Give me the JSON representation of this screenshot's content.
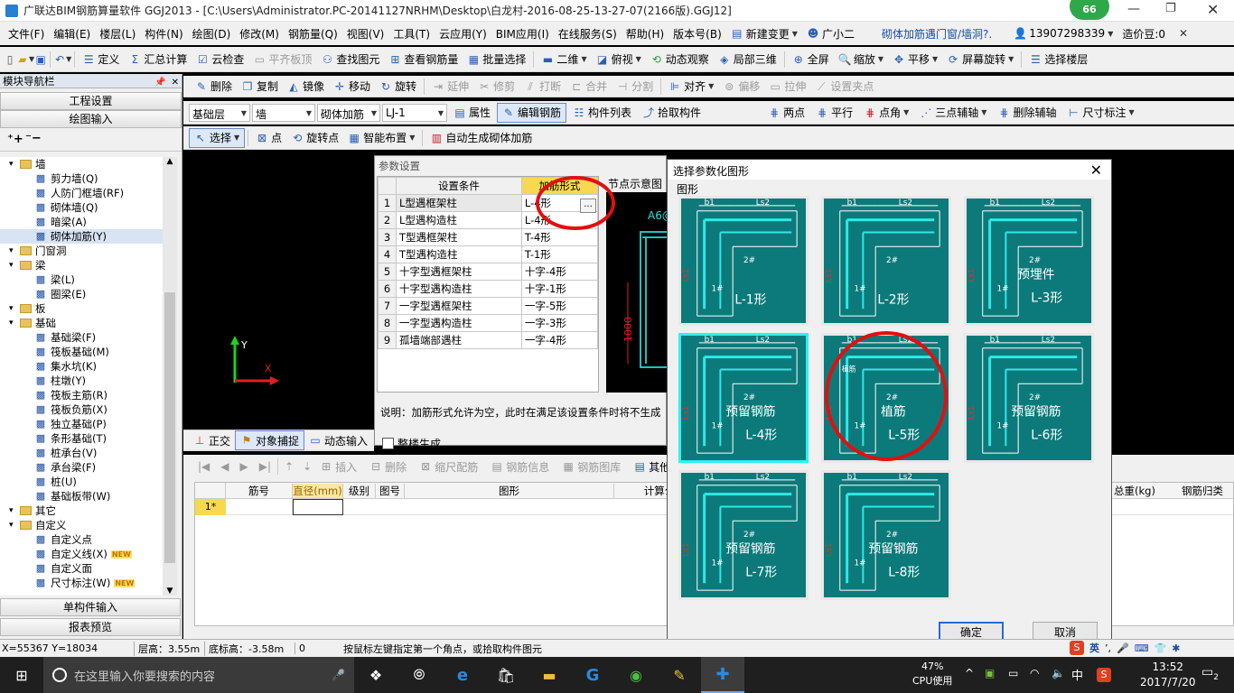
{
  "title": {
    "text": "广联达BIM钢筋算量软件 GGJ2013 - [C:\\Users\\Administrator.PC-20141127NRHM\\Desktop\\白龙村-2016-08-25-13-27-07(2166版).GGJ12]",
    "badge": "66"
  },
  "menu": [
    "文件(F)",
    "编辑(E)",
    "楼层(L)",
    "构件(N)",
    "绘图(D)",
    "修改(M)",
    "钢筋量(Q)",
    "视图(V)",
    "工具(T)",
    "云应用(Y)",
    "BIM应用(I)",
    "在线服务(S)",
    "帮助(H)",
    "版本号(B)",
    "新建变更",
    "广小二",
    "砌体加筋遇门窗/墙洞?.",
    "13907298339",
    "造价豆:0"
  ],
  "toolbar1": [
    "定义",
    "汇总计算",
    "云检查",
    "平齐板顶",
    "查找图元",
    "查看钢筋量",
    "批量选择",
    "二维",
    "俯视",
    "动态观察",
    "局部三维",
    "全屏",
    "缩放",
    "平移",
    "屏幕旋转",
    "选择楼层"
  ],
  "toolbar2": [
    "删除",
    "复制",
    "镜像",
    "移动",
    "旋转",
    "延伸",
    "修剪",
    "打断",
    "合并",
    "分割",
    "对齐",
    "偏移",
    "拉伸",
    "设置夹点"
  ],
  "toolbar3": {
    "floor": "基础层",
    "type": "墙",
    "sub": "砌体加筋",
    "name": "LJ-1",
    "items": [
      "属性",
      "编辑钢筋",
      "构件列表",
      "拾取构件",
      "两点",
      "平行",
      "点角",
      "三点辅轴",
      "删除辅轴",
      "尺寸标注"
    ]
  },
  "toolbar4": [
    "选择",
    "点",
    "旋转点",
    "智能布置",
    "自动生成砌体加筋"
  ],
  "left": {
    "title": "模块导航栏",
    "btn_project": "工程设置",
    "btn_draw": "绘图输入",
    "tree": [
      {
        "t": "墙",
        "lvl": 0,
        "type": "folder"
      },
      {
        "t": "剪力墙(Q)",
        "lvl": 1
      },
      {
        "t": "人防门框墙(RF)",
        "lvl": 1
      },
      {
        "t": "砌体墙(Q)",
        "lvl": 1
      },
      {
        "t": "暗梁(A)",
        "lvl": 1
      },
      {
        "t": "砌体加筋(Y)",
        "lvl": 1,
        "sel": true
      },
      {
        "t": "门窗洞",
        "lvl": 0,
        "type": "folder"
      },
      {
        "t": "梁",
        "lvl": 0,
        "type": "folder"
      },
      {
        "t": "梁(L)",
        "lvl": 1
      },
      {
        "t": "圈梁(E)",
        "lvl": 1
      },
      {
        "t": "板",
        "lvl": 0,
        "type": "folder"
      },
      {
        "t": "基础",
        "lvl": 0,
        "type": "folder"
      },
      {
        "t": "基础梁(F)",
        "lvl": 1
      },
      {
        "t": "筏板基础(M)",
        "lvl": 1
      },
      {
        "t": "集水坑(K)",
        "lvl": 1
      },
      {
        "t": "柱墩(Y)",
        "lvl": 1
      },
      {
        "t": "筏板主筋(R)",
        "lvl": 1
      },
      {
        "t": "筏板负筋(X)",
        "lvl": 1
      },
      {
        "t": "独立基础(P)",
        "lvl": 1
      },
      {
        "t": "条形基础(T)",
        "lvl": 1
      },
      {
        "t": "桩承台(V)",
        "lvl": 1
      },
      {
        "t": "承台梁(F)",
        "lvl": 1
      },
      {
        "t": "桩(U)",
        "lvl": 1
      },
      {
        "t": "基础板带(W)",
        "lvl": 1
      },
      {
        "t": "其它",
        "lvl": 0,
        "type": "folder"
      },
      {
        "t": "自定义",
        "lvl": 0,
        "type": "folder"
      },
      {
        "t": "自定义点",
        "lvl": 1
      },
      {
        "t": "自定义线(X)",
        "lvl": 1,
        "new": true
      },
      {
        "t": "自定义面",
        "lvl": 1
      },
      {
        "t": "尺寸标注(W)",
        "lvl": 1,
        "new": true
      }
    ],
    "new_badge": "NEW",
    "btn_single": "单构件输入",
    "btn_report": "报表预览"
  },
  "param_dialog": {
    "title": "参数设置",
    "col1": "设置条件",
    "col2": "加筋形式",
    "preview_title": "节点示意图",
    "rows": [
      {
        "n": "1",
        "c": "L型遇框架柱",
        "f": "L-4形"
      },
      {
        "n": "2",
        "c": "L型遇构造柱",
        "f": "L-4形"
      },
      {
        "n": "3",
        "c": "T型遇框架柱",
        "f": "T-4形"
      },
      {
        "n": "4",
        "c": "T型遇构造柱",
        "f": "T-1形"
      },
      {
        "n": "5",
        "c": "十字型遇框架柱",
        "f": "十字-4形"
      },
      {
        "n": "6",
        "c": "十字型遇构造柱",
        "f": "十字-1形"
      },
      {
        "n": "7",
        "c": "一字型遇框架柱",
        "f": "一字-5形"
      },
      {
        "n": "8",
        "c": "一字型遇构造柱",
        "f": "一字-3形"
      },
      {
        "n": "9",
        "c": "孤墙端部遇柱",
        "f": "一字-4形"
      }
    ],
    "ellipsis": "...",
    "note": "说明：加筋形式允许为空，此时在满足该设置条件时将不生成",
    "checkbox": "整楼生成",
    "preview_label": "A6@",
    "preview_dim": "1000"
  },
  "bottom_toolbar": [
    "正交",
    "对象捕捉",
    "动态输入"
  ],
  "rebar_toolbar": [
    "插入",
    "删除",
    "缩尺配筋",
    "钢筋信息",
    "钢筋图库",
    "其他"
  ],
  "rebar_table": {
    "cols": [
      "筋号",
      "直径(mm)",
      "级别",
      "图号",
      "图形",
      "计算公"
    ],
    "right_cols": [
      "总重(kg)",
      "钢筋归类"
    ],
    "row1": "1*"
  },
  "shape_dialog": {
    "title": "选择参数化图形",
    "group": "图形",
    "ok": "确定",
    "cancel": "取消",
    "tiles": [
      {
        "label": "L-1形",
        "sel": false
      },
      {
        "label": "L-2形",
        "sel": false
      },
      {
        "label": "预埋件",
        "label2": "L-3形",
        "sel": false
      },
      {
        "label": "预留钢筋",
        "label2": "L-4形",
        "sel": true
      },
      {
        "label": "植筋",
        "label2": "L-5形",
        "sel": false
      },
      {
        "label": "预留钢筋",
        "label2": "L-6形",
        "sel": false
      },
      {
        "label": "预留钢筋",
        "label2": "L-7形",
        "sel": false
      },
      {
        "label": "预留钢筋",
        "label2": "L-8形",
        "sel": false
      }
    ],
    "tile_dims": {
      "b1": "b1",
      "b2": "b2",
      "ls2": "Ls2",
      "ls1": "Ls1",
      "r1": "1#",
      "r2": "2#",
      "r3": "3#",
      "zhijin": "植筋",
      "fanghu": "预埋"
    }
  },
  "status": {
    "xy": "X=55367 Y=18034",
    "floor_h": "层高：3.55m",
    "base_h": "底标高：-3.58m",
    "zero": "0",
    "hint": "按鼠标左键指定第一个角点，或拾取构件图元"
  },
  "taskbar": {
    "search": "在这里输入你要搜索的内容",
    "cpu_pct": "47%",
    "cpu_label": "CPU使用",
    "ime": "中",
    "time": "13:52",
    "date": "2017/7/20",
    "notif": "2",
    "ime_lang": "英"
  },
  "colors": {
    "teal": "#0c7a7a",
    "accent": "#1a4fa0",
    "red_circle": "#e01010"
  }
}
